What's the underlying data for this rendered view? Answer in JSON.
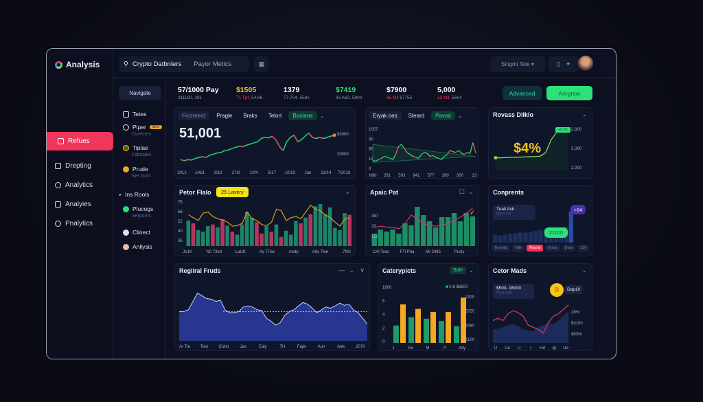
{
  "app": {
    "title": "Analysis"
  },
  "sidebar": {
    "items": [
      {
        "label": "Refues",
        "active": true
      },
      {
        "label": "Drepting"
      },
      {
        "label": "Analytics"
      },
      {
        "label": "Analyies"
      },
      {
        "label": "Pnalytics"
      }
    ]
  },
  "header": {
    "search": "Crypto Datbnlers",
    "search_sub": "Payor Metics",
    "user_menu": "Singmi Tete ▾"
  },
  "nav": {
    "button": "Navigate",
    "items": [
      {
        "label": "Tetes"
      },
      {
        "label": "Piper",
        "sub": "Curecers",
        "badge": "NEW"
      },
      {
        "label": "Tiplae",
        "sub": "Faltsales"
      },
      {
        "label": "Prude",
        "sub": "Ner Dots"
      },
      {
        "label": "Plucogs",
        "sub": "Serpoins"
      },
      {
        "label": "Clinect"
      },
      {
        "label": "Anllysis"
      }
    ],
    "section": "Ins Rools"
  },
  "stats": [
    {
      "value": "57/1000 Pay",
      "sub": "311160, 391",
      "color": "#ffffff"
    },
    {
      "value": "$1505",
      "red": "71 Tpf,",
      "sub": "54.6K",
      "color": "#f5c518"
    },
    {
      "value": "1379",
      "sub": "77.704, 559s",
      "color": "#ffffff"
    },
    {
      "value": "$7419",
      "sub": "93 A60, 5800",
      "color": "#2ee07a"
    },
    {
      "value": "$7900",
      "red": "85 Mil",
      "sub": "$7755",
      "color": "#ffffff"
    },
    {
      "value": "5,000",
      "red": "12 Mil,",
      "sub": "5664",
      "color": "#ffffff"
    }
  ],
  "buttons": {
    "advanced": "Advanced",
    "action": "Anrgrion"
  },
  "colors": {
    "accent_red": "#f0365a",
    "accent_green": "#2ee07a",
    "accent_yellow": "#f5c518",
    "bg": "#0c1020",
    "card": "#101629"
  },
  "cards": {
    "price": {
      "tabs": [
        "Fectreerd",
        "Pragle",
        "Braks",
        "Telort",
        "Boolane"
      ],
      "big": "51,001",
      "yticks": [
        "$3000",
        "20000"
      ],
      "xticks": [
        "2012",
        "1A61",
        "3/13",
        "27/6",
        "10/4",
        "5/17",
        "10/13",
        "Jun",
        "13/14",
        "7/2016"
      ]
    },
    "spread": {
      "tabs": [
        "Eryak oes",
        "Steard",
        "Pavod"
      ],
      "yticks": [
        "1057",
        "90",
        "80",
        "10",
        "0"
      ],
      "xticks": [
        "N90",
        "281",
        "593",
        "941",
        "577",
        "280",
        "300",
        "23"
      ]
    },
    "ravass": {
      "title": "Rovass Dilklo",
      "big": "$4%",
      "tag": "+0.5%",
      "yticks": [
        "2,800",
        "3,000",
        "2,000"
      ]
    },
    "factor": {
      "title": "Petor Flalo",
      "tooltip": "25 Lavery",
      "yticks": [
        "75",
        "58",
        "52",
        "40",
        "35"
      ],
      "xticks": [
        "Jo1K",
        "N0 73ed",
        "LaUK",
        "Ay TFae",
        "Aedp",
        "Ady 7lee",
        "7NS"
      ]
    },
    "apais": {
      "title": "Apaic Pat",
      "yticks": [
        "387",
        "20",
        "150"
      ],
      "xticks": [
        "CAl Teas",
        "FTl Poa",
        "MI 2495",
        "Pusly"
      ]
    },
    "comp": {
      "title": "Conprents",
      "box": "Tuail Ask",
      "box_sub": "Rasl curay",
      "purple": "+84",
      "green": "21100",
      "chips": [
        "Boovits",
        "Title",
        "Round",
        "Erros",
        "Dres",
        "120"
      ]
    },
    "regional": {
      "title": "Regiiral Fruds",
      "xticks": [
        "Ar Tle",
        "Test",
        "Civlst",
        "Jas",
        "Ealy",
        "TH",
        "Fapn",
        "Aun",
        "Awk",
        "2070"
      ]
    },
    "category": {
      "title": "Caterypicts",
      "pill": "Sole",
      "legend": "0-8 $6500",
      "lticks": [
        "1600",
        "6",
        "4",
        "2",
        "0"
      ],
      "rticks": [
        "2200",
        "2020",
        "2080",
        "2100"
      ],
      "xticks": [
        "1",
        "Aw",
        "M",
        "P",
        "Ady"
      ]
    },
    "cetor": {
      "title": "Cetor Mads",
      "box": "$50/l- 16000",
      "box_sub": "Posal Sutgr",
      "coin": "B",
      "coin_label": "Dap10",
      "rticks": [
        "28%",
        "$3100",
        "$83%"
      ],
      "xticks": [
        "U",
        "Ue",
        "U",
        "I",
        "Hd",
        "Jp",
        "Ue"
      ]
    }
  },
  "chart_data": [
    {
      "id": "price",
      "type": "line",
      "ylim": [
        18,
        35
      ],
      "values": [
        21,
        20.5,
        21,
        20.8,
        21.5,
        22,
        22.3,
        22,
        23,
        23.5,
        24,
        24.2,
        25,
        25.3,
        26,
        26.5,
        27,
        26.8,
        27.5,
        28,
        28.5,
        29,
        30.5,
        31,
        30.8,
        31.5,
        30,
        27,
        25,
        29,
        31,
        32,
        29,
        30,
        31.5,
        33,
        31,
        30.5,
        31,
        30.5,
        31,
        31.5,
        32
      ]
    },
    {
      "id": "spread",
      "type": "line",
      "ylim": [
        0,
        100
      ],
      "values": [
        20,
        18,
        22,
        25,
        30,
        28,
        25,
        22,
        35,
        55,
        60,
        50,
        40,
        35,
        30,
        28,
        25,
        35,
        40,
        38,
        30,
        32,
        28,
        25,
        22,
        30,
        35,
        45,
        42,
        40,
        45,
        38,
        35,
        40,
        37,
        65,
        38
      ]
    },
    {
      "id": "ravass",
      "type": "area",
      "ylim": [
        0,
        70
      ],
      "values": [
        10,
        10,
        10.5,
        11,
        11,
        11.5,
        12,
        12.5,
        13,
        20,
        45,
        60,
        62,
        65
      ]
    },
    {
      "id": "factor",
      "type": "bar_line",
      "ylim": [
        0,
        80
      ],
      "bars": [
        45,
        40,
        28,
        25,
        35,
        38,
        33,
        47,
        36,
        25,
        20,
        38,
        60,
        50,
        42,
        22,
        35,
        25,
        38,
        16,
        27,
        20,
        44,
        40,
        50,
        56,
        70,
        74,
        56,
        68,
        32,
        28,
        58,
        55
      ],
      "up": [
        1,
        0,
        1,
        1,
        1,
        0,
        1,
        0,
        1,
        0,
        1,
        1,
        1,
        1,
        0,
        0,
        1,
        0,
        1,
        0,
        1,
        1,
        1,
        0,
        1,
        0,
        1,
        1,
        1,
        1,
        1,
        1,
        1,
        0
      ],
      "line": [
        55,
        50,
        45,
        58,
        60,
        52,
        48,
        46,
        42,
        35,
        36,
        40,
        60,
        48,
        45,
        38,
        36,
        42,
        65,
        62,
        45,
        50,
        52,
        48,
        60,
        72,
        65,
        62,
        55,
        50,
        42,
        35,
        48,
        50
      ]
    },
    {
      "id": "apais",
      "type": "bar_line",
      "ylim": [
        0,
        100
      ],
      "bars": [
        30,
        40,
        35,
        40,
        30,
        55,
        50,
        95,
        75,
        60,
        45,
        70,
        70,
        80,
        60,
        80,
        72
      ],
      "line": [
        45,
        48,
        46,
        45,
        42,
        55,
        75,
        65,
        55,
        50,
        48,
        50,
        55,
        62,
        70,
        80,
        92
      ]
    },
    {
      "id": "comp",
      "type": "bar",
      "ylim": [
        0,
        100
      ],
      "values": [
        20,
        18,
        20,
        22,
        24,
        26,
        25,
        27,
        30,
        32,
        34,
        36,
        34,
        38,
        40,
        80
      ]
    },
    {
      "id": "regional",
      "type": "area",
      "ylim": [
        0,
        100
      ],
      "ref": 52,
      "values": [
        52,
        52,
        55,
        70,
        85,
        80,
        75,
        74,
        70,
        72,
        55,
        50,
        50,
        52,
        60,
        62,
        60,
        55,
        54,
        40,
        35,
        28,
        32,
        45,
        52,
        55,
        62,
        68,
        65,
        58,
        50,
        55,
        60,
        58,
        62,
        67,
        63,
        65,
        55,
        50,
        40,
        30
      ]
    },
    {
      "id": "category",
      "type": "grouped_bar",
      "ylim": [
        0,
        7
      ],
      "series": [
        {
          "color": "#1f9a6b",
          "values": [
            2.3,
            3.4,
            3.2,
            2.9,
            2.2
          ]
        },
        {
          "color": "#f5a623",
          "values": [
            5.1,
            4.5,
            4.1,
            4.1,
            6.0
          ]
        }
      ]
    },
    {
      "id": "cetor",
      "type": "area_line",
      "ylim": [
        0,
        100
      ],
      "area": [
        30,
        32,
        35,
        40,
        42,
        38,
        30,
        28,
        25,
        35,
        40,
        45,
        42,
        50,
        60,
        70
      ],
      "line": [
        50,
        55,
        50,
        65,
        72,
        68,
        60,
        40,
        35,
        30,
        22,
        45,
        60,
        65,
        75,
        85
      ]
    }
  ]
}
